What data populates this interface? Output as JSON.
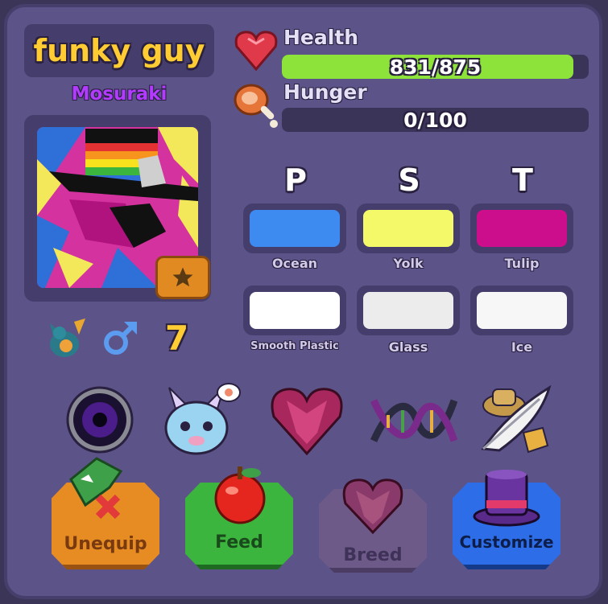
{
  "pet": {
    "name": "funky guy",
    "owner": "Mosuraki",
    "level": "7"
  },
  "stats": {
    "health": {
      "label": "Health",
      "value_text": "831/875",
      "fraction": 0.95
    },
    "hunger": {
      "label": "Hunger",
      "value_text": "0/100",
      "fraction": 0.0
    }
  },
  "traits": {
    "headers": [
      "P",
      "S",
      "T"
    ],
    "colors": [
      {
        "label": "Ocean",
        "hex": "#3d8bf0"
      },
      {
        "label": "Yolk",
        "hex": "#f4f96a"
      },
      {
        "label": "Tulip",
        "hex": "#cc0d8c"
      }
    ],
    "materials": [
      {
        "label": "Smooth Plastic",
        "hex": "#ffffff"
      },
      {
        "label": "Glass",
        "hex": "#ececec"
      },
      {
        "label": "Ice",
        "hex": "#f7f7f7"
      }
    ]
  },
  "icons": {
    "species": "dragon-icon",
    "gender": "male-icon",
    "favorite": "star-icon",
    "health": "heart-gem-icon",
    "hunger": "meat-icon"
  },
  "accessories": [
    {
      "icon": "void-orb-icon"
    },
    {
      "icon": "baby-dragon-icon"
    },
    {
      "icon": "heart-gem-icon"
    },
    {
      "icon": "dna-icon"
    },
    {
      "icon": "feather-hat-icon"
    }
  ],
  "actions": [
    {
      "label": "Unequip",
      "icon": "unequip-dragon-icon",
      "color": "#e68c23",
      "enabled": true
    },
    {
      "label": "Feed",
      "icon": "apple-icon",
      "color": "#3bb53d",
      "enabled": true
    },
    {
      "label": "Breed",
      "icon": "heart-gem-icon",
      "color": "#6e5a88",
      "enabled": false
    },
    {
      "label": "Customize",
      "icon": "top-hat-icon",
      "color": "#2d6ee8",
      "enabled": true
    }
  ]
}
